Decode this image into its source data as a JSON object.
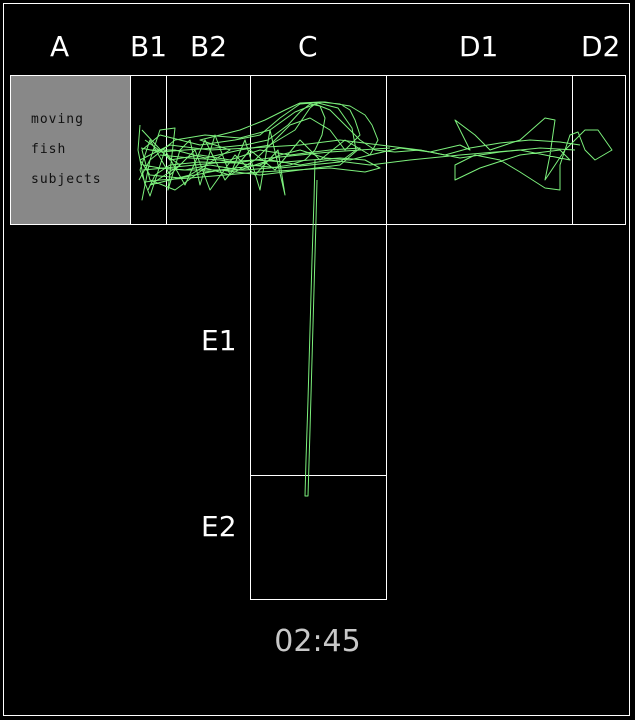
{
  "zones": {
    "A": "A",
    "B1": "B1",
    "B2": "B2",
    "C": "C",
    "D1": "D1",
    "D2": "D2",
    "E1": "E1",
    "E2": "E2"
  },
  "start_box": {
    "line1": "moving",
    "line2": "fish",
    "line3": "subjects"
  },
  "timer": "02:45",
  "colors": {
    "background": "#000000",
    "outline": "#ffffff",
    "start_box_fill": "#888888",
    "trajectory": "#7cf07c",
    "timer_text": "#c8c8c8"
  }
}
